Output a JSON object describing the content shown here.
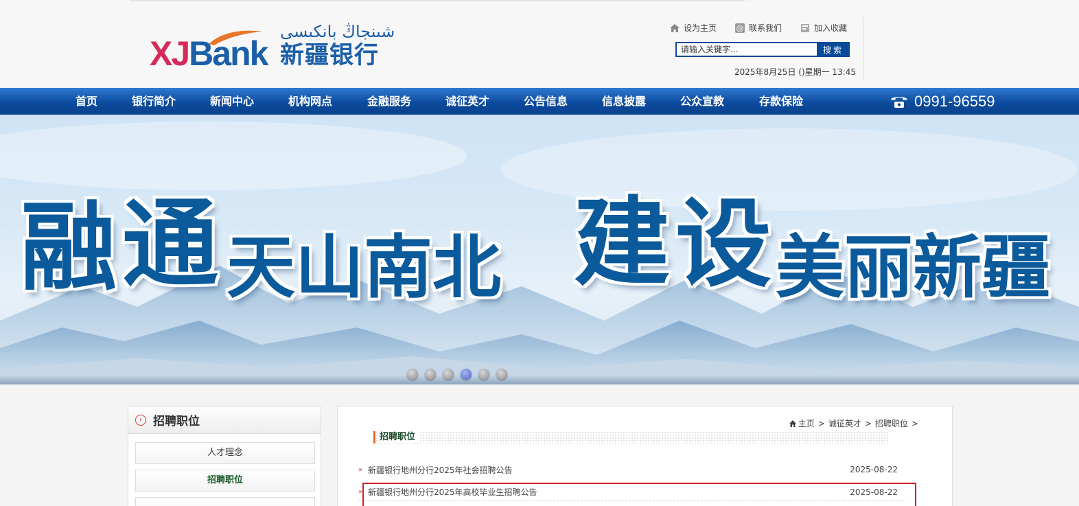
{
  "header": {
    "logo_en_x": "XJ",
    "logo_en_rest": "Bank",
    "logo_ug": "شىنجاڭ بانكىسى",
    "logo_cn": "新疆银行",
    "links": [
      {
        "label": "设为主页",
        "icon": "home-icon"
      },
      {
        "label": "联系我们",
        "icon": "at-icon"
      },
      {
        "label": "加入收藏",
        "icon": "bookmark-icon"
      }
    ],
    "search": {
      "placeholder": "请输入关键字...",
      "button": "搜索"
    },
    "datetime": "2025年8月25日 ()星期一 13:45"
  },
  "nav": {
    "items": [
      "首页",
      "银行简介",
      "新闻中心",
      "机构网点",
      "金融服务",
      "诚征英才",
      "公告信息",
      "信息披露",
      "公众宣教",
      "存款保险"
    ],
    "hotline": "0991-96559",
    "hotline_icon": "phone-icon"
  },
  "banner": {
    "slogan": [
      "融",
      "通",
      "天山南北",
      "建",
      "设",
      "美丽新疆"
    ],
    "dots": 6,
    "active_dot": 4
  },
  "sidebar": {
    "title": "招聘职位",
    "items": [
      {
        "label": "人才理念",
        "active": false
      },
      {
        "label": "招聘职位",
        "active": true
      },
      {
        "label": "",
        "active": false
      }
    ]
  },
  "breadcrumb": {
    "home": "主页",
    "level1": "诚征英才",
    "level2": "招聘职位"
  },
  "section_title": "招聘职位",
  "news": [
    {
      "title": "新疆银行地州分行2025年社会招聘公告",
      "date": "2025-08-22"
    },
    {
      "title": "新疆银行地州分行2025年高校毕业生招聘公告",
      "date": "2025-08-22"
    }
  ],
  "colors": {
    "brand_blue": "#0a4a9a",
    "slogan_blue": "#0b5a9b",
    "accent_red": "#d0202a",
    "accent_orange": "#e06a1d"
  }
}
